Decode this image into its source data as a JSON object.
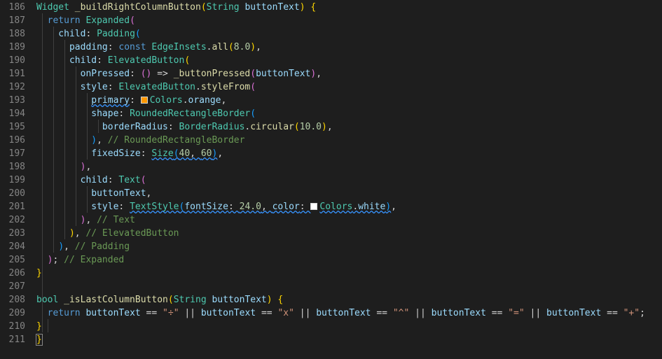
{
  "colors": {
    "background": "#1e1e1e",
    "swatch_orange": "#ff9800",
    "swatch_white": "#ffffff"
  },
  "gutter": [
    "186",
    "187",
    "188",
    "189",
    "190",
    "191",
    "192",
    "193",
    "194",
    "195",
    "196",
    "197",
    "198",
    "199",
    "200",
    "201",
    "202",
    "203",
    "204",
    "205",
    "206",
    "207",
    "208",
    "209",
    "210",
    "211"
  ],
  "lines": [
    [
      {
        "t": "Widget",
        "c": "tk-ty"
      },
      {
        "t": " ",
        "c": "tk-pu"
      },
      {
        "t": "_buildRightColumnButton",
        "c": "tk-fn"
      },
      {
        "t": "(",
        "c": "tk-br1"
      },
      {
        "t": "String",
        "c": "tk-ty"
      },
      {
        "t": " ",
        "c": "tk-pu"
      },
      {
        "t": "buttonText",
        "c": "tk-pa"
      },
      {
        "t": ")",
        "c": "tk-br1"
      },
      {
        "t": " ",
        "c": "tk-pu"
      },
      {
        "t": "{",
        "c": "tk-br1"
      }
    ],
    [
      {
        "t": "  return ",
        "c": "tk-kw"
      },
      {
        "t": "Expanded",
        "c": "tk-ty"
      },
      {
        "t": "(",
        "c": "tk-br2"
      }
    ],
    [
      {
        "t": "    child",
        "c": "tk-pa"
      },
      {
        "t": ": ",
        "c": "tk-pu"
      },
      {
        "t": "Padding",
        "c": "tk-ty"
      },
      {
        "t": "(",
        "c": "tk-br3"
      }
    ],
    [
      {
        "t": "      padding",
        "c": "tk-pa"
      },
      {
        "t": ": ",
        "c": "tk-pu"
      },
      {
        "t": "const ",
        "c": "tk-kw"
      },
      {
        "t": "EdgeInsets",
        "c": "tk-ty"
      },
      {
        "t": ".",
        "c": "tk-pu"
      },
      {
        "t": "all",
        "c": "tk-fn"
      },
      {
        "t": "(",
        "c": "tk-br1"
      },
      {
        "t": "8.0",
        "c": "tk-nu"
      },
      {
        "t": ")",
        "c": "tk-br1"
      },
      {
        "t": ",",
        "c": "tk-pu"
      }
    ],
    [
      {
        "t": "      child",
        "c": "tk-pa"
      },
      {
        "t": ": ",
        "c": "tk-pu"
      },
      {
        "t": "ElevatedButton",
        "c": "tk-ty"
      },
      {
        "t": "(",
        "c": "tk-br1"
      }
    ],
    [
      {
        "t": "        onPressed",
        "c": "tk-pa"
      },
      {
        "t": ": ",
        "c": "tk-pu"
      },
      {
        "t": "()",
        "c": "tk-br2"
      },
      {
        "t": " => ",
        "c": "tk-pu"
      },
      {
        "t": "_buttonPressed",
        "c": "tk-fn"
      },
      {
        "t": "(",
        "c": "tk-br2"
      },
      {
        "t": "buttonText",
        "c": "tk-pa"
      },
      {
        "t": ")",
        "c": "tk-br2"
      },
      {
        "t": ",",
        "c": "tk-pu"
      }
    ],
    [
      {
        "t": "        style",
        "c": "tk-pa"
      },
      {
        "t": ": ",
        "c": "tk-pu"
      },
      {
        "t": "ElevatedButton",
        "c": "tk-ty"
      },
      {
        "t": ".",
        "c": "tk-pu"
      },
      {
        "t": "styleFrom",
        "c": "tk-fn"
      },
      {
        "t": "(",
        "c": "tk-br2"
      }
    ],
    [
      {
        "t": "          ",
        "c": "tk-pu"
      },
      {
        "t": "primary",
        "c": "tk-pa strike squig"
      },
      {
        "t": ": ",
        "c": "tk-pu"
      },
      {
        "swatch": "swatch_orange"
      },
      {
        "t": "Colors",
        "c": "tk-ty"
      },
      {
        "t": ".",
        "c": "tk-pu"
      },
      {
        "t": "orange",
        "c": "tk-pa"
      },
      {
        "t": ",",
        "c": "tk-pu"
      }
    ],
    [
      {
        "t": "          shape",
        "c": "tk-pa"
      },
      {
        "t": ": ",
        "c": "tk-pu"
      },
      {
        "t": "RoundedRectangleBorder",
        "c": "tk-ty"
      },
      {
        "t": "(",
        "c": "tk-br3"
      }
    ],
    [
      {
        "t": "            borderRadius",
        "c": "tk-pa"
      },
      {
        "t": ": ",
        "c": "tk-pu"
      },
      {
        "t": "BorderRadius",
        "c": "tk-ty"
      },
      {
        "t": ".",
        "c": "tk-pu"
      },
      {
        "t": "circular",
        "c": "tk-fn"
      },
      {
        "t": "(",
        "c": "tk-br1"
      },
      {
        "t": "10.0",
        "c": "tk-nu"
      },
      {
        "t": ")",
        "c": "tk-br1"
      },
      {
        "t": ",",
        "c": "tk-pu"
      }
    ],
    [
      {
        "t": "          ",
        "c": "tk-pu"
      },
      {
        "t": ")",
        "c": "tk-br3"
      },
      {
        "t": ", ",
        "c": "tk-pu"
      },
      {
        "t": "// RoundedRectangleBorder",
        "c": "tk-cm"
      }
    ],
    [
      {
        "t": "          fixedSize",
        "c": "tk-pa"
      },
      {
        "t": ": ",
        "c": "tk-pu"
      },
      {
        "t": "Size",
        "c": "tk-ty squig"
      },
      {
        "t": "(",
        "c": "tk-br3 squig"
      },
      {
        "t": "40",
        "c": "tk-nu squig"
      },
      {
        "t": ", ",
        "c": "tk-pu squig"
      },
      {
        "t": "60",
        "c": "tk-nu squig"
      },
      {
        "t": ")",
        "c": "tk-br3 squig"
      },
      {
        "t": ",",
        "c": "tk-pu"
      }
    ],
    [
      {
        "t": "        ",
        "c": "tk-pu"
      },
      {
        "t": ")",
        "c": "tk-br2"
      },
      {
        "t": ",",
        "c": "tk-pu"
      }
    ],
    [
      {
        "t": "        child",
        "c": "tk-pa"
      },
      {
        "t": ": ",
        "c": "tk-pu"
      },
      {
        "t": "Text",
        "c": "tk-ty"
      },
      {
        "t": "(",
        "c": "tk-br2"
      }
    ],
    [
      {
        "t": "          buttonText",
        "c": "tk-pa"
      },
      {
        "t": ",",
        "c": "tk-pu"
      }
    ],
    [
      {
        "t": "          style",
        "c": "tk-pa"
      },
      {
        "t": ": ",
        "c": "tk-pu"
      },
      {
        "t": "TextStyle",
        "c": "tk-ty squig"
      },
      {
        "t": "(",
        "c": "tk-br3 squig"
      },
      {
        "t": "fontSize",
        "c": "tk-pa squig"
      },
      {
        "t": ": ",
        "c": "tk-pu squig"
      },
      {
        "t": "24.0",
        "c": "tk-nu squig"
      },
      {
        "t": ", ",
        "c": "tk-pu squig"
      },
      {
        "t": "color",
        "c": "tk-pa squig"
      },
      {
        "t": ": ",
        "c": "tk-pu squig"
      },
      {
        "swatch": "swatch_white"
      },
      {
        "t": "Colors",
        "c": "tk-ty squig"
      },
      {
        "t": ".",
        "c": "tk-pu squig"
      },
      {
        "t": "white",
        "c": "tk-pa squig"
      },
      {
        "t": ")",
        "c": "tk-br3 squig"
      },
      {
        "t": ",",
        "c": "tk-pu"
      }
    ],
    [
      {
        "t": "        ",
        "c": "tk-pu"
      },
      {
        "t": ")",
        "c": "tk-br2"
      },
      {
        "t": ", ",
        "c": "tk-pu"
      },
      {
        "t": "// Text",
        "c": "tk-cm"
      }
    ],
    [
      {
        "t": "      ",
        "c": "tk-pu"
      },
      {
        "t": ")",
        "c": "tk-br1"
      },
      {
        "t": ", ",
        "c": "tk-pu"
      },
      {
        "t": "// ElevatedButton",
        "c": "tk-cm"
      }
    ],
    [
      {
        "t": "    ",
        "c": "tk-pu"
      },
      {
        "t": ")",
        "c": "tk-br3"
      },
      {
        "t": ", ",
        "c": "tk-pu"
      },
      {
        "t": "// Padding",
        "c": "tk-cm"
      }
    ],
    [
      {
        "t": "  ",
        "c": "tk-pu"
      },
      {
        "t": ")",
        "c": "tk-br2"
      },
      {
        "t": "; ",
        "c": "tk-pu"
      },
      {
        "t": "// Expanded",
        "c": "tk-cm"
      }
    ],
    [
      {
        "t": "}",
        "c": "tk-br1"
      }
    ],
    [],
    [
      {
        "t": "bool",
        "c": "tk-ty"
      },
      {
        "t": " ",
        "c": "tk-pu"
      },
      {
        "t": "_isLastColumnButton",
        "c": "tk-fn"
      },
      {
        "t": "(",
        "c": "tk-br1"
      },
      {
        "t": "String",
        "c": "tk-ty"
      },
      {
        "t": " ",
        "c": "tk-pu"
      },
      {
        "t": "buttonText",
        "c": "tk-pa"
      },
      {
        "t": ")",
        "c": "tk-br1"
      },
      {
        "t": " ",
        "c": "tk-pu"
      },
      {
        "t": "{",
        "c": "tk-br1"
      }
    ],
    [
      {
        "t": "  return ",
        "c": "tk-kw"
      },
      {
        "t": "buttonText",
        "c": "tk-pa"
      },
      {
        "t": " == ",
        "c": "tk-pu"
      },
      {
        "t": "\"÷\"",
        "c": "tk-st"
      },
      {
        "t": " || ",
        "c": "tk-pu"
      },
      {
        "t": "buttonText",
        "c": "tk-pa"
      },
      {
        "t": " == ",
        "c": "tk-pu"
      },
      {
        "t": "\"x\"",
        "c": "tk-st"
      },
      {
        "t": " || ",
        "c": "tk-pu"
      },
      {
        "t": "buttonText",
        "c": "tk-pa"
      },
      {
        "t": " == ",
        "c": "tk-pu"
      },
      {
        "t": "\"^\"",
        "c": "tk-st"
      },
      {
        "t": " || ",
        "c": "tk-pu"
      },
      {
        "t": "buttonText",
        "c": "tk-pa"
      },
      {
        "t": " == ",
        "c": "tk-pu"
      },
      {
        "t": "\"=\"",
        "c": "tk-st"
      },
      {
        "t": " || ",
        "c": "tk-pu"
      },
      {
        "t": "buttonText",
        "c": "tk-pa"
      },
      {
        "t": " == ",
        "c": "tk-pu"
      },
      {
        "t": "\"+\"",
        "c": "tk-st"
      },
      {
        "t": ";",
        "c": "tk-pu"
      }
    ],
    [
      {
        "t": "}",
        "c": "tk-br1"
      }
    ],
    [
      {
        "t": "}",
        "c": "tk-br1 cursor-brace"
      }
    ]
  ]
}
